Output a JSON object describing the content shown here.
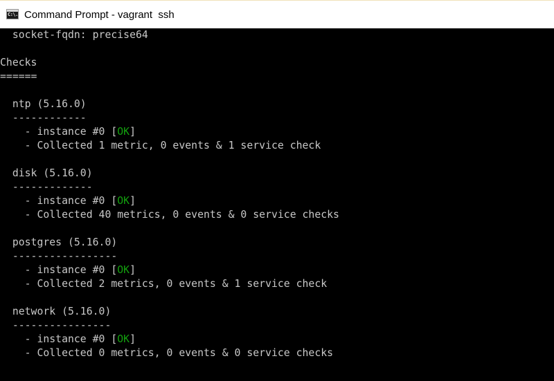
{
  "window": {
    "title": "Command Prompt - vagrant  ssh",
    "icon": "cmd-icon",
    "icon_text": "C:\\."
  },
  "colors": {
    "console_bg": "#000000",
    "console_text": "#c8c8c8",
    "ok_status": "#13a10e",
    "titlebar_bg": "#ffffff"
  },
  "console": {
    "header_line": "  socket-fqdn: precise64",
    "checks_heading": "Checks",
    "checks_underline": "======",
    "checks": [
      {
        "title": "  ntp (5.16.0)",
        "underline": "  ------------",
        "instance_prefix": "    - instance #0 [",
        "status": "OK",
        "instance_suffix": "]",
        "collected": "    - Collected 1 metric, 0 events & 1 service check"
      },
      {
        "title": "  disk (5.16.0)",
        "underline": "  -------------",
        "instance_prefix": "    - instance #0 [",
        "status": "OK",
        "instance_suffix": "]",
        "collected": "    - Collected 40 metrics, 0 events & 0 service checks"
      },
      {
        "title": "  postgres (5.16.0)",
        "underline": "  -----------------",
        "instance_prefix": "    - instance #0 [",
        "status": "OK",
        "instance_suffix": "]",
        "collected": "    - Collected 2 metrics, 0 events & 1 service check"
      },
      {
        "title": "  network (5.16.0)",
        "underline": "  ----------------",
        "instance_prefix": "    - instance #0 [",
        "status": "OK",
        "instance_suffix": "]",
        "collected": "    - Collected 0 metrics, 0 events & 0 service checks"
      }
    ]
  }
}
